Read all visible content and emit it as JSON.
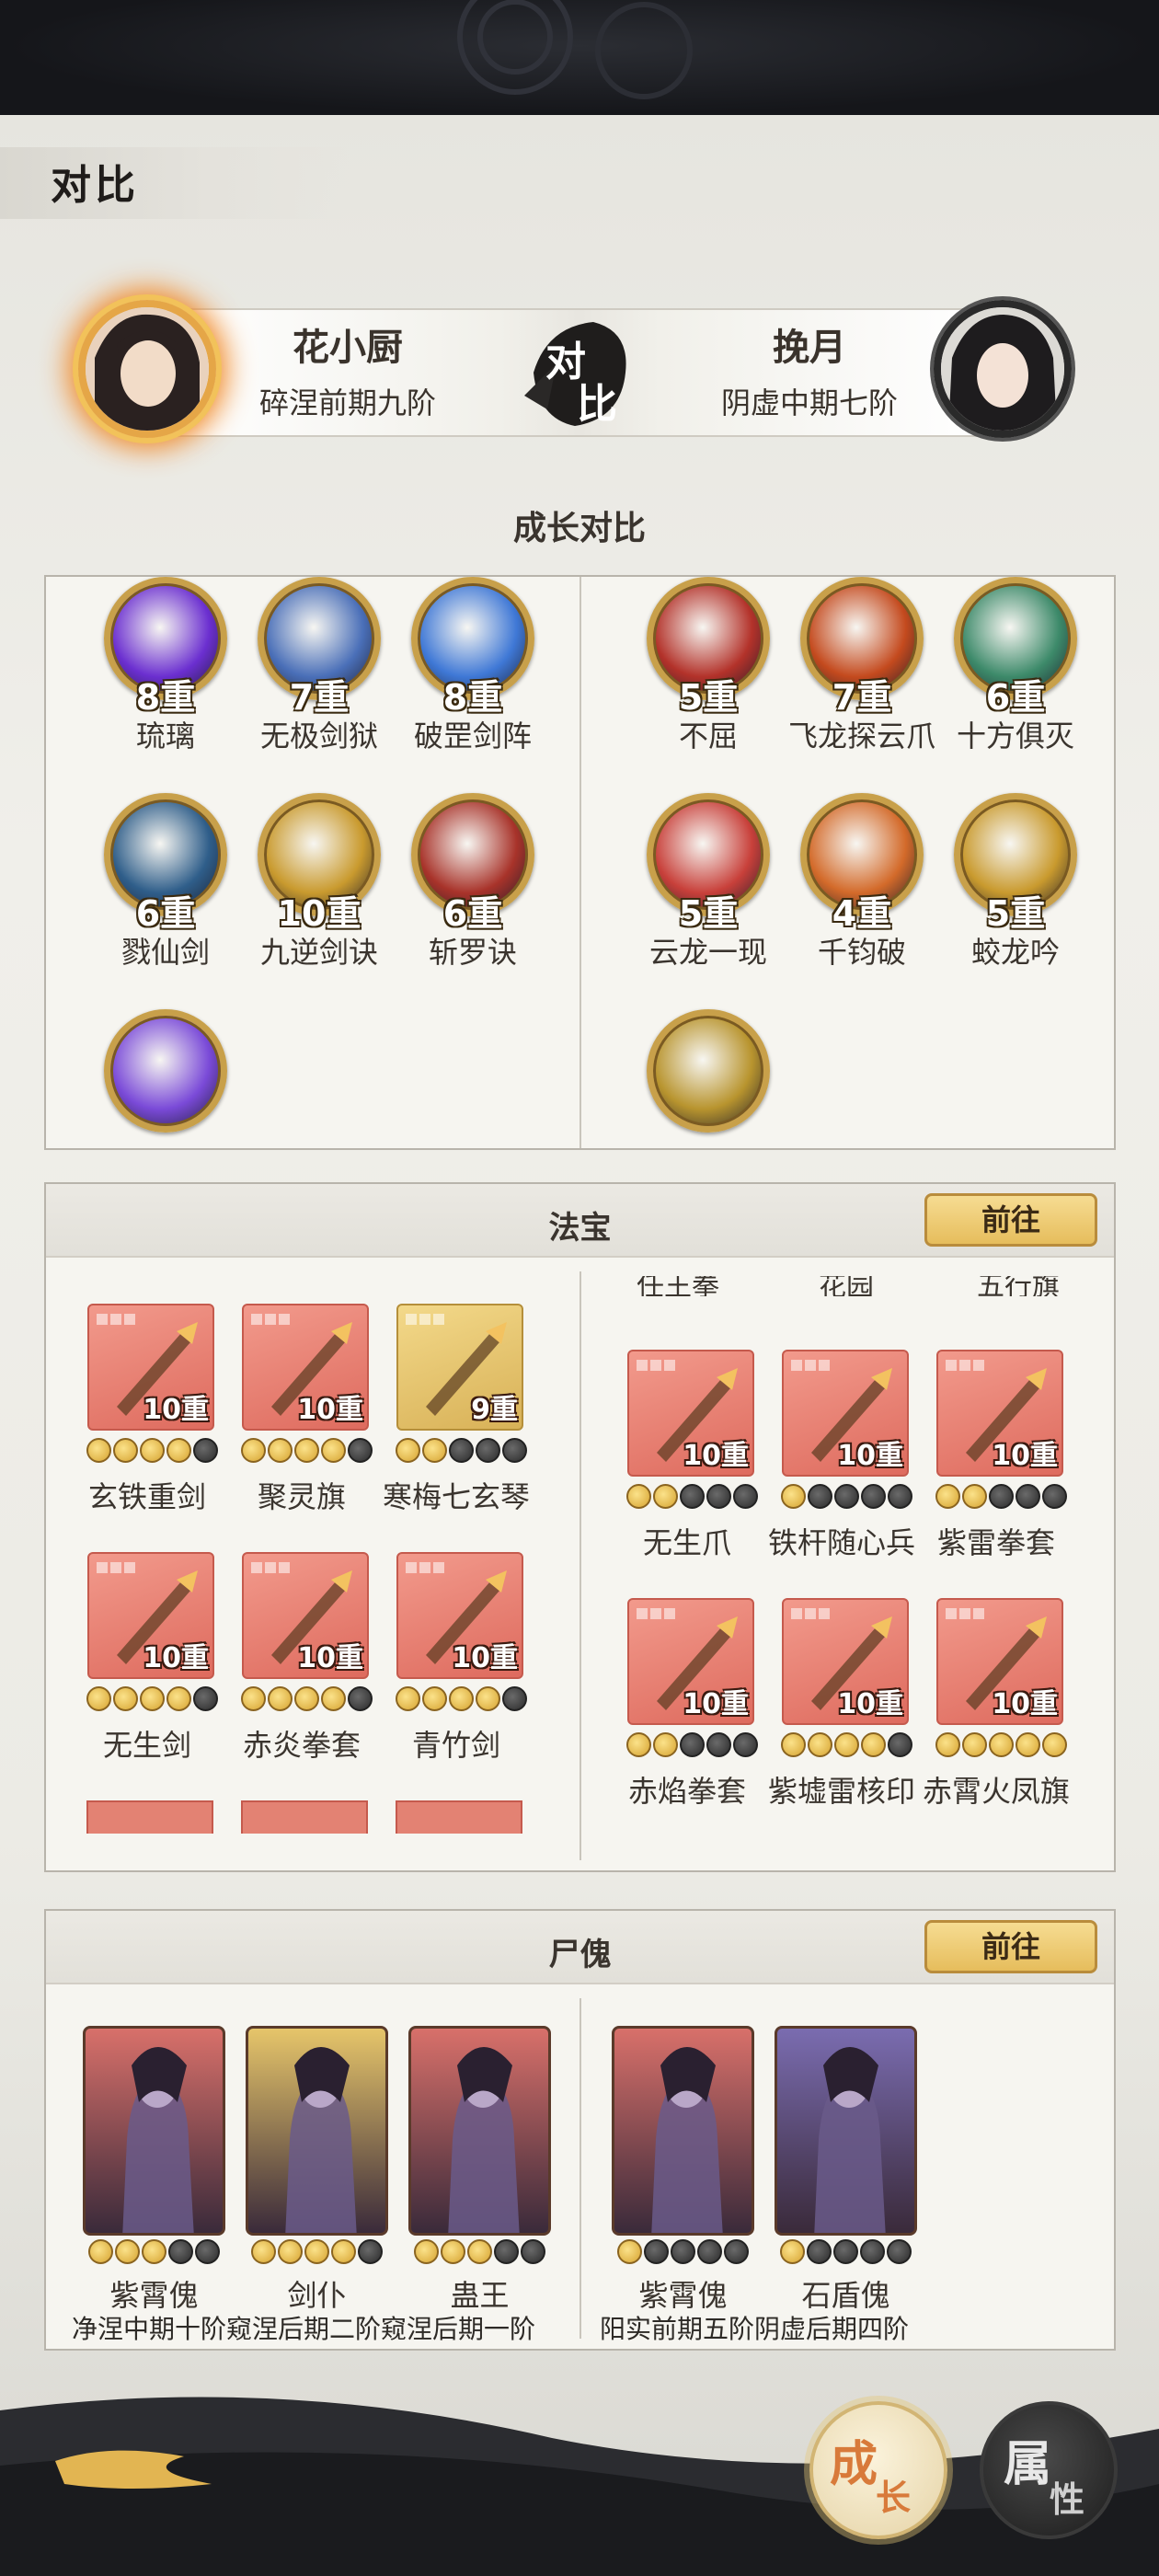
{
  "page": {
    "title": "对比"
  },
  "players": {
    "left": {
      "name": "花小厨",
      "rank": "碎涅前期九阶"
    },
    "right": {
      "name": "挽月",
      "rank": "阴虚中期七阶"
    },
    "vs_badge": [
      "对",
      "比"
    ]
  },
  "growth_section": {
    "label": "成长对比"
  },
  "skills": {
    "left": [
      {
        "name": "琉璃",
        "level": "8重",
        "color": "#6b2fd0"
      },
      {
        "name": "无极剑狱",
        "level": "7重",
        "color": "#4a6fb8"
      },
      {
        "name": "破罡剑阵",
        "level": "8重",
        "color": "#3f78d6"
      },
      {
        "name": "戮仙剑",
        "level": "6重",
        "color": "#2f5e8a"
      },
      {
        "name": "九逆剑诀",
        "level": "10重",
        "color": "#c99a2e"
      },
      {
        "name": "斩罗诀",
        "level": "6重",
        "color": "#a8332a"
      },
      {
        "name": "",
        "level": "",
        "color": "#7a4ad8"
      }
    ],
    "right": [
      {
        "name": "不屈",
        "level": "5重",
        "color": "#b3322a"
      },
      {
        "name": "飞龙探云爪",
        "level": "7重",
        "color": "#c44a1e"
      },
      {
        "name": "十方俱灭",
        "level": "6重",
        "color": "#3d8a6a"
      },
      {
        "name": "云龙一现",
        "level": "5重",
        "color": "#c8403a"
      },
      {
        "name": "千钧破",
        "level": "4重",
        "color": "#d36a2a"
      },
      {
        "name": "蛟龙吟",
        "level": "5重",
        "color": "#c99a2e"
      },
      {
        "name": "",
        "level": "",
        "color": "#b8942e"
      }
    ]
  },
  "treasure": {
    "title": "法宝",
    "go_label": "前往",
    "left": [
      {
        "name": "玄铁重剑",
        "level": "10重",
        "stars_on": 4,
        "gold": false
      },
      {
        "name": "聚灵旗",
        "level": "10重",
        "stars_on": 4,
        "gold": false
      },
      {
        "name": "寒梅七玄琴",
        "level": "9重",
        "stars_on": 2,
        "gold": true
      },
      {
        "name": "无生剑",
        "level": "10重",
        "stars_on": 4,
        "gold": false
      },
      {
        "name": "赤炎拳套",
        "level": "10重",
        "stars_on": 4,
        "gold": false
      },
      {
        "name": "青竹剑",
        "level": "10重",
        "stars_on": 4,
        "gold": false
      }
    ],
    "right_top_cut": [
      "任王拳",
      "花园",
      "五行旗"
    ],
    "right": [
      {
        "name": "无生爪",
        "level": "10重",
        "stars_on": 2
      },
      {
        "name": "铁杆随心兵",
        "level": "10重",
        "stars_on": 1
      },
      {
        "name": "紫雷拳套",
        "level": "10重",
        "stars_on": 2
      },
      {
        "name": "赤焰拳套",
        "level": "10重",
        "stars_on": 2
      },
      {
        "name": "紫墟雷核印",
        "level": "10重",
        "stars_on": 4
      },
      {
        "name": "赤霄火凤旗",
        "level": "10重",
        "stars_on": 5
      }
    ]
  },
  "puppet": {
    "title": "尸傀",
    "go_label": "前往",
    "left": [
      {
        "name": "紫霄傀",
        "stars_on": 3,
        "bg": "#d8706a"
      },
      {
        "name": "剑仆",
        "stars_on": 4,
        "bg": "#e6c56a"
      },
      {
        "name": "蛊王",
        "stars_on": 3,
        "bg": "#d8706a"
      }
    ],
    "right": [
      {
        "name": "紫霄傀",
        "stars_on": 1,
        "bg": "#d8706a"
      },
      {
        "name": "石盾傀",
        "stars_on": 1,
        "bg": "#7a6cb0"
      }
    ],
    "left_ranks": "净涅中期十阶窥涅后期二阶窥涅后期一阶",
    "right_ranks": "阳实前期五阶阴虚后期四阶"
  },
  "bottom_buttons": {
    "grow": [
      "成",
      "长"
    ],
    "attr": [
      "属",
      "性"
    ]
  }
}
